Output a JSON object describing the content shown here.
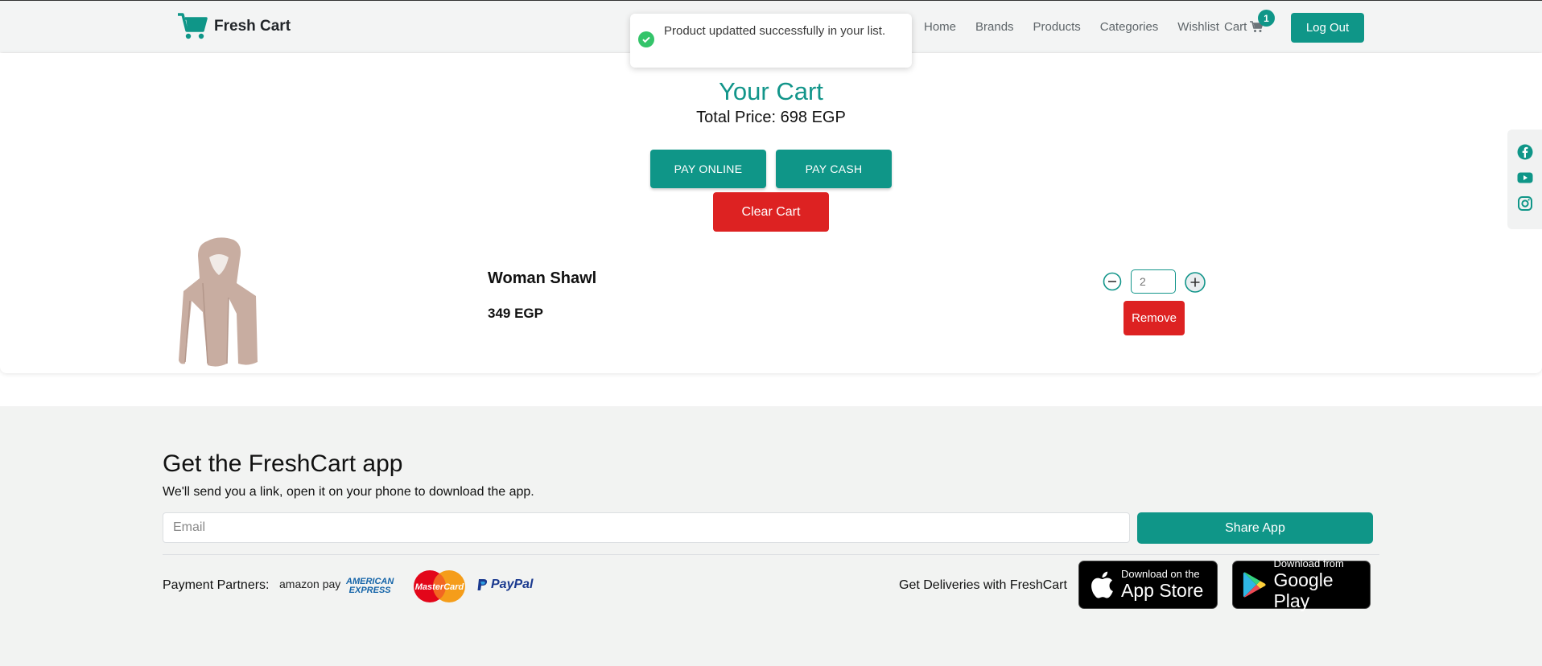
{
  "navbar": {
    "brand": "Fresh Cart",
    "links": [
      "Home",
      "Brands",
      "Products",
      "Categories",
      "Wishlist"
    ],
    "cart_label": "Cart",
    "cart_count": "1",
    "logout_label": "Log Out"
  },
  "toast": {
    "message": "Product updatted successfully in your list."
  },
  "cart": {
    "title": "Your Cart",
    "total_price": "Total Price: 698 EGP",
    "pay_online": "PAY ONLINE",
    "pay_cash": "PAY CASH",
    "clear_cart": "Clear Cart",
    "items": [
      {
        "name": "Woman Shawl",
        "price": "349 EGP",
        "quantity": "2",
        "remove_label": "Remove"
      }
    ]
  },
  "footer": {
    "app_title": "Get the FreshCart app",
    "app_desc": "We'll send you a link, open it on your phone to download the app.",
    "email_placeholder": "Email",
    "share_label": "Share App",
    "partners_label": "Payment Partners:",
    "partners": {
      "amazon": "amazon pay",
      "amex_line1": "AMERICAN",
      "amex_line2": "EXPRESS",
      "mastercard": "MasterCard",
      "paypal": "PayPal"
    },
    "deliveries_label": "Get Deliveries with FreshCart",
    "app_store_small": "Download on the",
    "app_store_big": "App Store",
    "google_play_small": "Download from",
    "google_play_big": "Google Play"
  },
  "colors": {
    "brand": "#0f9688",
    "danger": "#dd2222",
    "footer_bg": "#f2f3f2",
    "navbar_bg": "#f3f4f4"
  },
  "icons": [
    "cart-icon",
    "check-circle-icon",
    "minus-circle-icon",
    "plus-circle-icon",
    "facebook-icon",
    "youtube-icon",
    "instagram-icon",
    "apple-icon",
    "google-play-icon"
  ]
}
